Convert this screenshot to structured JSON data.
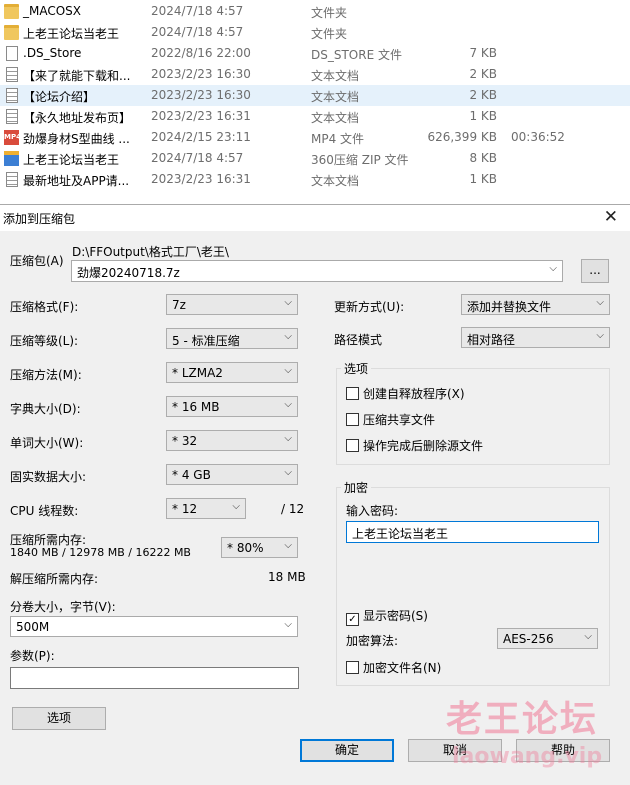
{
  "files": [
    {
      "icon": "folder",
      "name": "_MACOSX",
      "date": "2024/7/18 4:57",
      "type": "文件夹",
      "size": "",
      "duration": ""
    },
    {
      "icon": "folder",
      "name": "上老王论坛当老王",
      "date": "2024/7/18 4:57",
      "type": "文件夹",
      "size": "",
      "duration": ""
    },
    {
      "icon": "doc",
      "name": ".DS_Store",
      "date": "2022/8/16 22:00",
      "type": "DS_STORE 文件",
      "size": "7 KB",
      "duration": ""
    },
    {
      "icon": "txt",
      "name": "【来了就能下载和...",
      "date": "2023/2/23 16:30",
      "type": "文本文档",
      "size": "2 KB",
      "duration": ""
    },
    {
      "icon": "txt",
      "name": "【论坛介绍】",
      "date": "2023/2/23 16:30",
      "type": "文本文档",
      "size": "2 KB",
      "duration": "",
      "selected": true
    },
    {
      "icon": "txt",
      "name": "【永久地址发布页】",
      "date": "2023/2/23 16:31",
      "type": "文本文档",
      "size": "1 KB",
      "duration": ""
    },
    {
      "icon": "mp4",
      "name": "劲爆身材S型曲线 ...",
      "date": "2024/2/15 23:11",
      "type": "MP4 文件",
      "size": "626,399 KB",
      "duration": "00:36:52"
    },
    {
      "icon": "zip",
      "name": "上老王论坛当老王",
      "date": "2024/7/18 4:57",
      "type": "360压缩 ZIP 文件",
      "size": "8 KB",
      "duration": ""
    },
    {
      "icon": "txt",
      "name": "最新地址及APP请...",
      "date": "2023/2/23 16:31",
      "type": "文本文档",
      "size": "1 KB",
      "duration": ""
    }
  ],
  "dialog": {
    "title": "添加到压缩包",
    "close": "✕",
    "archive_label": "压缩包(A)",
    "archive_path": "D:\\FFOutput\\格式工厂\\老王\\",
    "archive_name": "劲爆20240718.7z",
    "browse": "...",
    "format_label": "压缩格式(F):",
    "format_value": "7z",
    "level_label": "压缩等级(L):",
    "level_value": "5 - 标准压缩",
    "method_label": "压缩方法(M):",
    "method_value": "*  LZMA2",
    "dict_label": "字典大小(D):",
    "dict_value": "*  16 MB",
    "word_label": "单词大小(W):",
    "word_value": "*  32",
    "solid_label": "固实数据大小:",
    "solid_value": "*  4 GB",
    "threads_label": "CPU 线程数:",
    "threads_value": "*  12",
    "threads_max": "/ 12",
    "mem_label": "压缩所需内存:",
    "mem_value": "1840 MB / 12978 MB / 16222 MB",
    "mem_pct": "* 80%",
    "demem_label": "解压缩所需内存:",
    "demem_value": "18 MB",
    "split_label": "分卷大小，字节(V):",
    "split_value": "500M",
    "params_label": "参数(P):",
    "params_value": "",
    "update_label": "更新方式(U):",
    "update_value": "添加并替换文件",
    "path_label": "路径模式",
    "path_value": "相对路径",
    "options_title": "选项",
    "opt_sfx": "创建自释放程序(X)",
    "opt_shared": "压缩共享文件",
    "opt_delete": "操作完成后删除源文件",
    "enc_title": "加密",
    "pwd_label": "输入密码:",
    "pwd_value": "上老王论坛当老王",
    "show_pwd": "显示密码(S)",
    "enc_method_label": "加密算法:",
    "enc_method_value": "AES-256",
    "enc_names": "加密文件名(N)",
    "btn_options": "选项",
    "btn_ok": "确定",
    "btn_cancel": "取消",
    "btn_help": "帮助",
    "checkmark": "✓",
    "arrow": "⌵"
  },
  "watermark": {
    "line1": "老王论坛",
    "line2": "laowang.vip"
  }
}
